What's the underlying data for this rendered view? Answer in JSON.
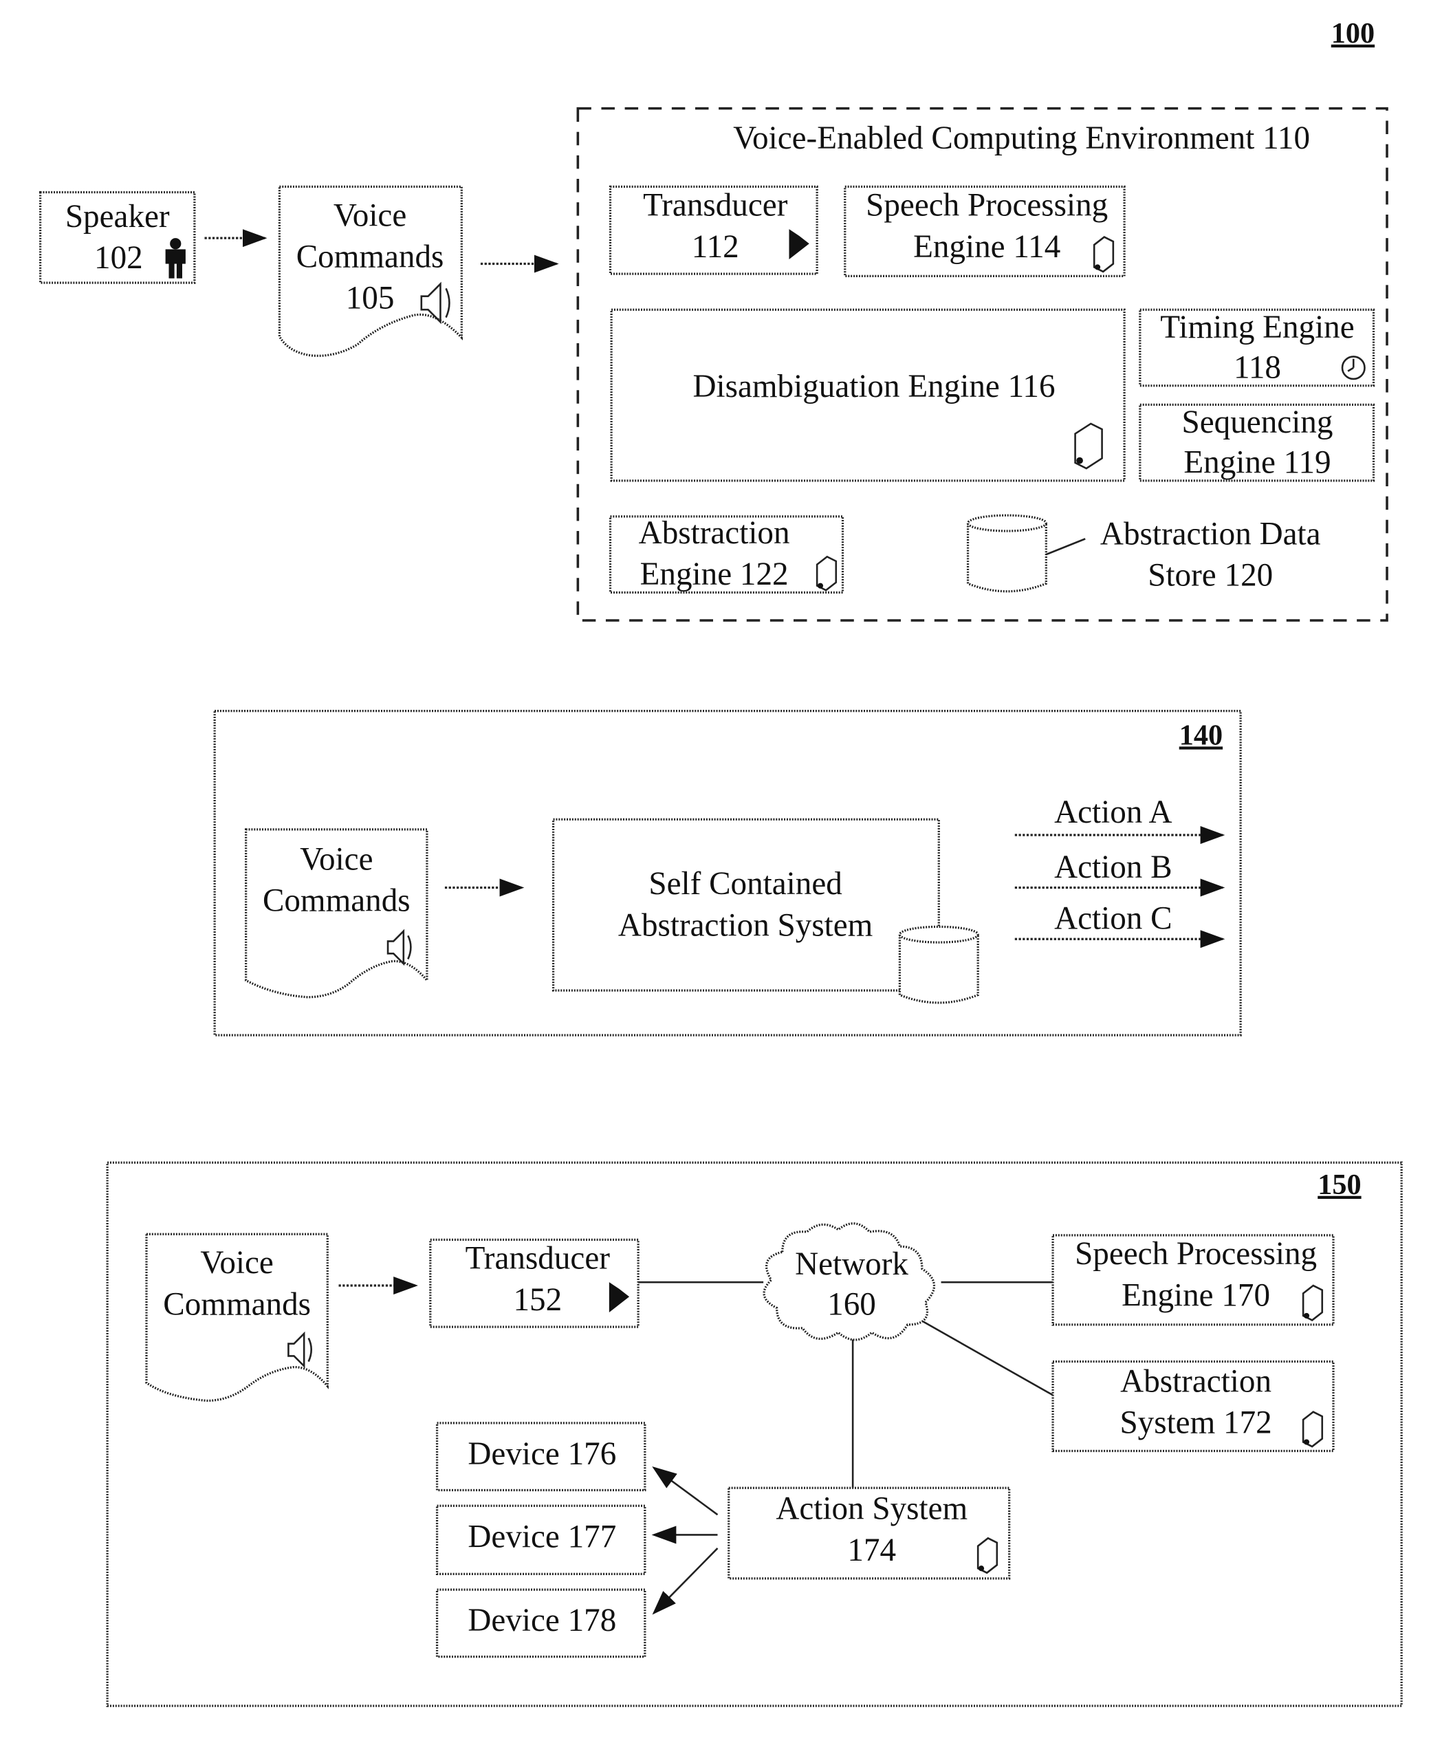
{
  "figure_100": {
    "ref": "100",
    "speaker": {
      "line1": "Speaker",
      "line2": "102"
    },
    "voice_commands": {
      "line1": "Voice",
      "line2": "Commands",
      "line3": "105"
    },
    "environment": {
      "title": "Voice-Enabled Computing Environment 110",
      "transducer": {
        "line1": "Transducer",
        "line2": "112"
      },
      "speech_processing": {
        "line1": "Speech Processing",
        "line2": "Engine 114"
      },
      "disambiguation": {
        "line1": "Disambiguation Engine 116"
      },
      "timing": {
        "line1": "Timing Engine",
        "line2": "118"
      },
      "sequencing": {
        "line1": "Sequencing",
        "line2": "Engine 119"
      },
      "abstraction_engine": {
        "line1": "Abstraction",
        "line2": "Engine 122"
      },
      "data_store": {
        "line1": "Abstraction Data",
        "line2": "Store 120"
      }
    }
  },
  "figure_140": {
    "ref": "140",
    "voice_commands": {
      "line1": "Voice",
      "line2": "Commands"
    },
    "system": {
      "line1": "Self Contained",
      "line2": "Abstraction System"
    },
    "actions": [
      "Action A",
      "Action B",
      "Action C"
    ]
  },
  "figure_150": {
    "ref": "150",
    "voice_commands": {
      "line1": "Voice",
      "line2": "Commands"
    },
    "transducer": {
      "line1": "Transducer",
      "line2": "152"
    },
    "network": {
      "line1": "Network",
      "line2": "160"
    },
    "speech_processing": {
      "line1": "Speech Processing",
      "line2": "Engine 170"
    },
    "abstraction_system": {
      "line1": "Abstraction",
      "line2": "System 172"
    },
    "action_system": {
      "line1": "Action System",
      "line2": "174"
    },
    "devices": [
      "Device 176",
      "Device 177",
      "Device 178"
    ]
  }
}
